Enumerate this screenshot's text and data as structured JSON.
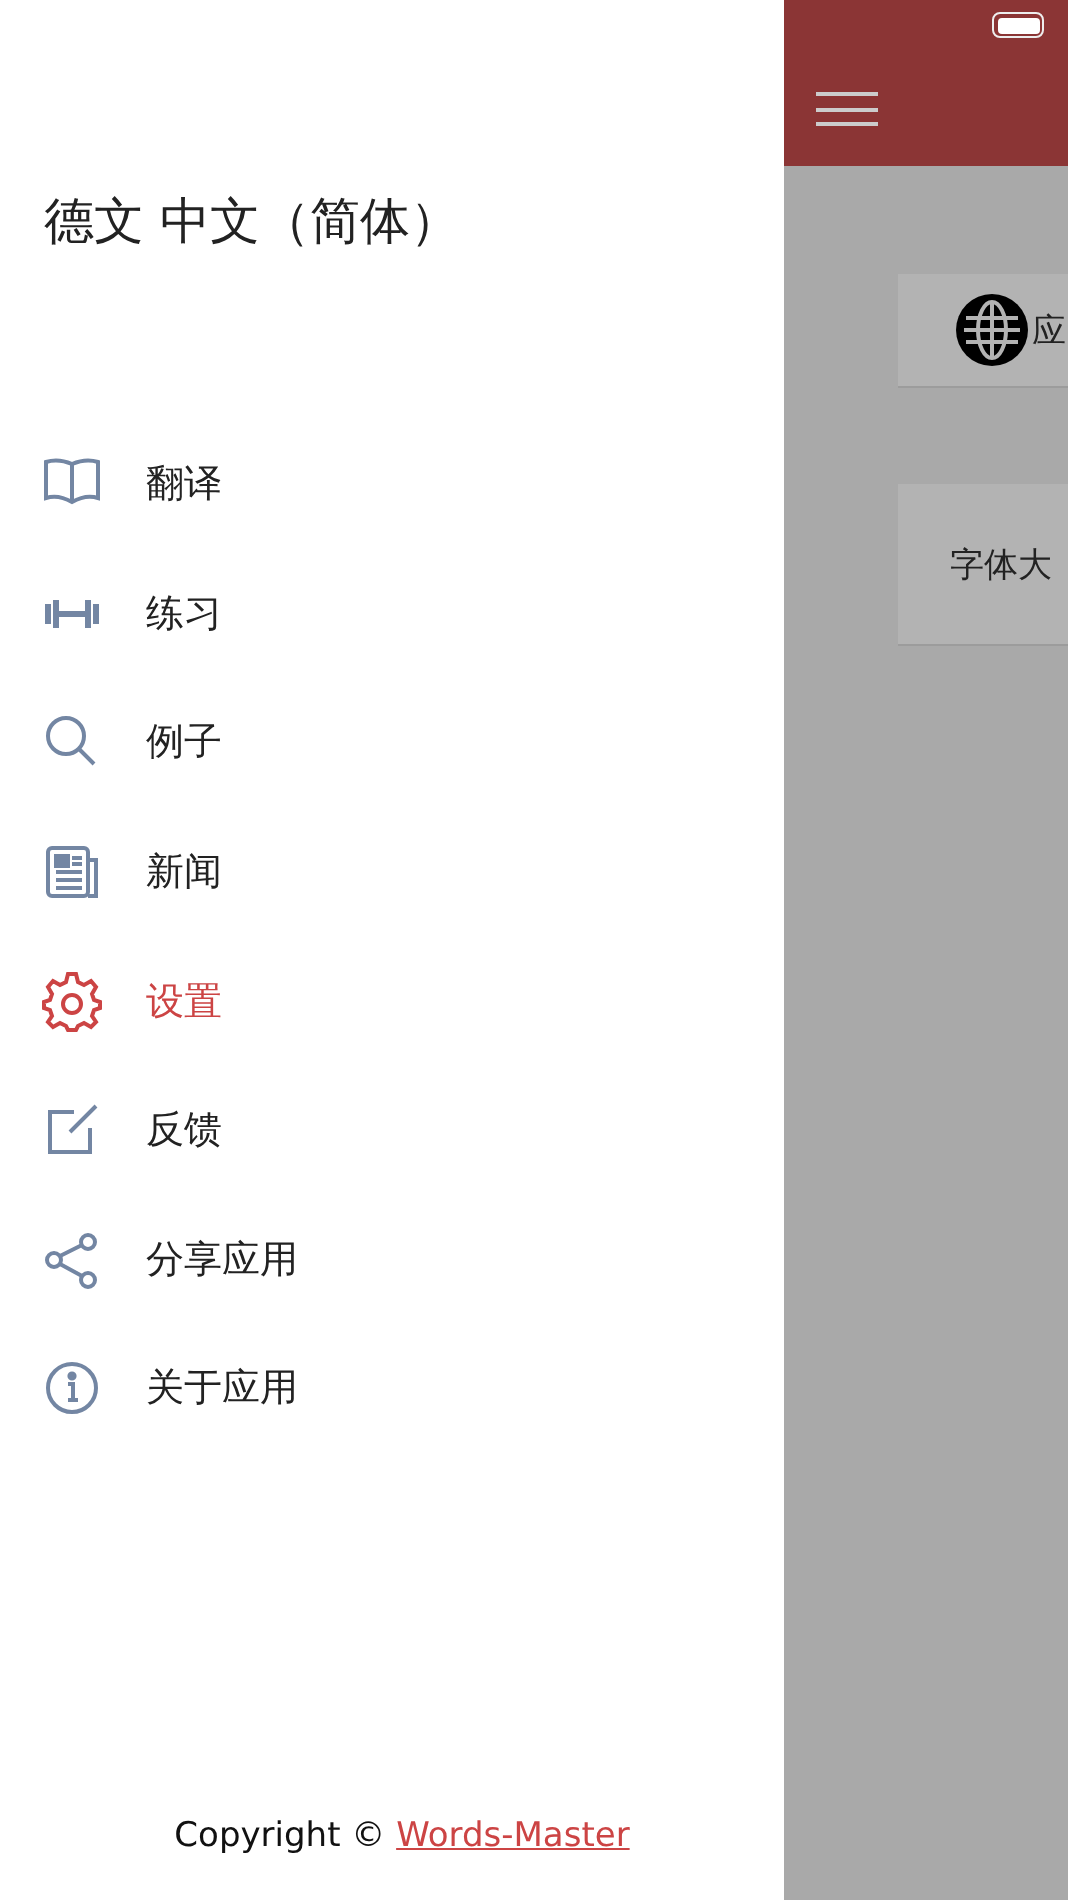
{
  "drawer": {
    "title": "德文 中文（简体）",
    "items": [
      {
        "label": "翻译",
        "selected": false
      },
      {
        "label": "练习",
        "selected": false
      },
      {
        "label": "例子",
        "selected": false
      },
      {
        "label": "新闻",
        "selected": false
      },
      {
        "label": "设置",
        "selected": true
      },
      {
        "label": "反馈",
        "selected": false
      },
      {
        "label": "分享应用",
        "selected": false
      },
      {
        "label": "关于应用",
        "selected": false
      }
    ],
    "footer": {
      "text": "Copyright ©",
      "link": "Words-Master"
    }
  },
  "background": {
    "cards": [
      {
        "kind": "language",
        "label": "应"
      },
      {
        "kind": "text",
        "label": "字体大"
      }
    ]
  }
}
